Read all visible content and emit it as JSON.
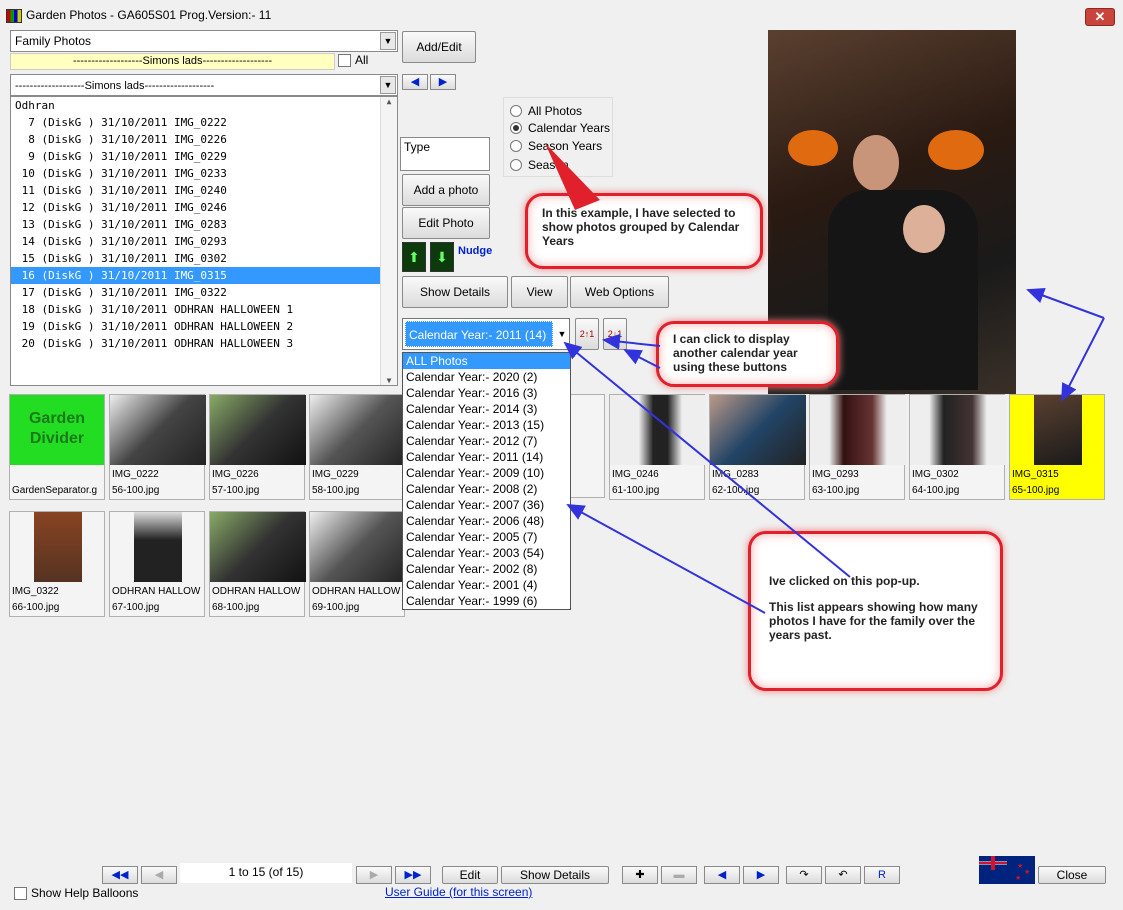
{
  "window": {
    "title": "Garden Photos - GA605S01   Prog.Version:-  11",
    "close_glyph": "✕"
  },
  "album_select": {
    "value": "Family Photos"
  },
  "group_bar": {
    "value": "-------------------Simons lads-------------------",
    "all_label": "All"
  },
  "group_select": {
    "value": "-------------------Simons lads-------------------"
  },
  "buttons": {
    "add_edit": "Add/Edit",
    "type_label": "Type",
    "add_photo": "Add a photo",
    "edit_photo": "Edit Photo",
    "nudge": "Nudge",
    "show_details": "Show Details",
    "view": "View",
    "web_options": "Web Options"
  },
  "radio": {
    "all_photos": "All Photos",
    "calendar_years": "Calendar Years",
    "season_years": "Season Years",
    "season": "Season"
  },
  "list": {
    "header": "Odhran",
    "rows": [
      "  7 (DiskG ) 31/10/2011 IMG_0222",
      "  8 (DiskG ) 31/10/2011 IMG_0226",
      "  9 (DiskG ) 31/10/2011 IMG_0229",
      " 10 (DiskG ) 31/10/2011 IMG_0233",
      " 11 (DiskG ) 31/10/2011 IMG_0240",
      " 12 (DiskG ) 31/10/2011 IMG_0246",
      " 13 (DiskG ) 31/10/2011 IMG_0283",
      " 14 (DiskG ) 31/10/2011 IMG_0293",
      " 15 (DiskG ) 31/10/2011 IMG_0302",
      " 16 (DiskG ) 31/10/2011 IMG_0315",
      " 17 (DiskG ) 31/10/2011 IMG_0322",
      " 18 (DiskG ) 31/10/2011 ODHRAN HALLOWEEN 1",
      " 19 (DiskG ) 31/10/2011 ODHRAN HALLOWEEN 2",
      " 20 (DiskG ) 31/10/2011 ODHRAN HALLOWEEN 3"
    ]
  },
  "year_combo": {
    "value": "Calendar Year:- 2011 (14)"
  },
  "sort_buttons": {
    "asc": "2↑1",
    "desc": "2↓1"
  },
  "dropdown": {
    "options": [
      "ALL Photos",
      "Calendar Year:- 2020 (2)",
      "Calendar Year:- 2016 (3)",
      "Calendar Year:- 2014 (3)",
      "Calendar Year:- 2013 (15)",
      "Calendar Year:- 2012 (7)",
      "Calendar Year:- 2011 (14)",
      "Calendar Year:- 2009 (10)",
      "Calendar Year:- 2008 (2)",
      "Calendar Year:- 2007 (36)",
      "Calendar Year:- 2006 (48)",
      "Calendar Year:- 2005 (7)",
      "Calendar Year:- 2003 (54)",
      "Calendar Year:- 2002 (8)",
      "Calendar Year:- 2001 (4)",
      "Calendar Year:- 1999 (6)"
    ]
  },
  "callouts": {
    "c1": "In this example, I have selected to show photos grouped by Calendar Years",
    "c2": "I can click to display another calendar year using these buttons",
    "c3a": "Ive clicked on this pop-up.",
    "c3b": "This list appears showing how many photos I have for the family over the years past."
  },
  "thumbs": {
    "divider_text": "Garden Divider",
    "t0": {
      "l1": "",
      "l2": "GardenSeparator.g"
    },
    "t1": {
      "l1": "IMG_0222",
      "l2": "56-100.jpg"
    },
    "t2": {
      "l1": "IMG_0226",
      "l2": "57-100.jpg"
    },
    "t3": {
      "l1": "IMG_0229",
      "l2": "58-100.jpg"
    },
    "t6": {
      "l1": "IMG_0246",
      "l2": "61-100.jpg"
    },
    "t7": {
      "l1": "IMG_0283",
      "l2": "62-100.jpg"
    },
    "t8": {
      "l1": "IMG_0293",
      "l2": "63-100.jpg"
    },
    "t9": {
      "l1": "IMG_0302",
      "l2": "64-100.jpg"
    },
    "t10": {
      "l1": "IMG_0315",
      "l2": "65-100.jpg"
    },
    "t11": {
      "l1": "IMG_0322",
      "l2": "66-100.jpg"
    },
    "t12": {
      "l1": "ODHRAN HALLOW",
      "l2": "67-100.jpg"
    },
    "t13": {
      "l1": "ODHRAN HALLOW",
      "l2": "68-100.jpg"
    },
    "t14": {
      "l1": "ODHRAN HALLOW",
      "l2": "69-100.jpg"
    }
  },
  "footer": {
    "page_info": "1 to 15 (of 15)",
    "edit": "Edit",
    "show_details": "Show Details",
    "r": "R",
    "close": "Close",
    "help_balloons": "Show Help Balloons",
    "user_guide": "User Guide (for this screen)"
  },
  "colors": {
    "selection": "#3399ff",
    "highlight_thumb": "#ffff00",
    "callout_border": "#e0202a",
    "arrow": "#3333dd",
    "divider_green": "#22dd22"
  }
}
